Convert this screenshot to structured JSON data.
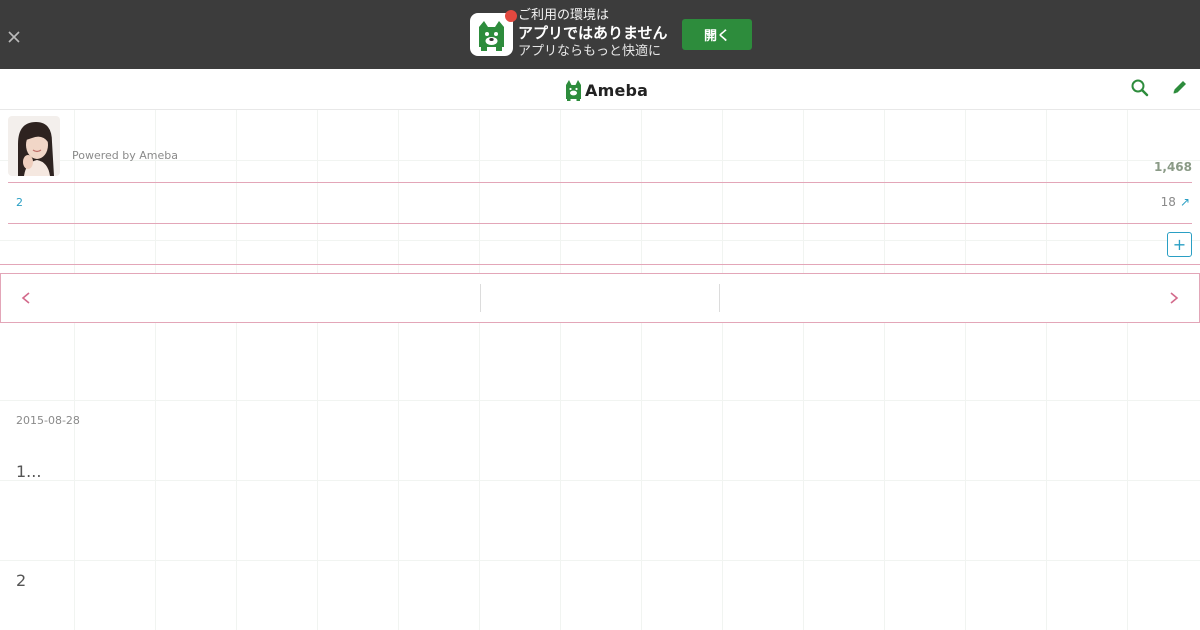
{
  "banner": {
    "line1": "ご利用の環境は",
    "line2": "アプリではありません",
    "line3": "アプリならもっと快適に",
    "open_label": "開く"
  },
  "header": {
    "logo_text": "Ameba",
    "search_icon": "search-icon",
    "edit_icon": "pencil-icon"
  },
  "profile": {
    "powered_by": "Powered by Ameba",
    "follower_count": "1,468"
  },
  "stats_row": {
    "left_value": "2",
    "right_value": "18",
    "right_arrow": "↗"
  },
  "add_button_label": "+",
  "article": {
    "date": "2015-08-28",
    "text_1": "1...",
    "text_2": "2"
  },
  "colors": {
    "banner_bg": "#3c3c3c",
    "open_button": "#2d8c3c",
    "ameba_green": "#2d8c3c",
    "accent_pink": "#e3a6b8",
    "link_blue": "#2a9fc4"
  }
}
